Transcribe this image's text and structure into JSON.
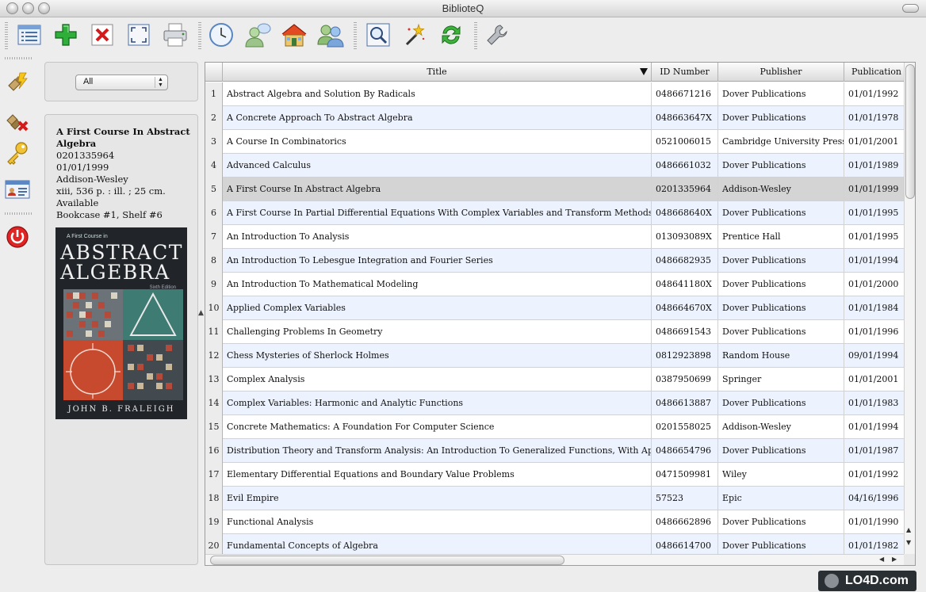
{
  "window": {
    "title": "BiblioteQ"
  },
  "toolbar": {
    "items": [
      {
        "icon": "list-view-icon"
      },
      {
        "icon": "add-icon"
      },
      {
        "icon": "delete-icon"
      },
      {
        "icon": "fullscreen-icon"
      },
      {
        "icon": "printer-icon"
      },
      {
        "icon": "clock-icon"
      },
      {
        "icon": "user-chat-icon"
      },
      {
        "icon": "home-icon"
      },
      {
        "icon": "users-icon"
      },
      {
        "icon": "search-icon"
      },
      {
        "icon": "magic-wand-icon"
      },
      {
        "icon": "refresh-icon"
      },
      {
        "icon": "wrench-icon"
      }
    ]
  },
  "side_toolbar": {
    "items": [
      {
        "icon": "connect-icon"
      },
      {
        "icon": "disconnect-icon"
      },
      {
        "icon": "key-icon"
      },
      {
        "icon": "id-card-icon"
      },
      {
        "icon": "power-icon"
      }
    ]
  },
  "filter": {
    "selected": "All"
  },
  "details": {
    "title": "A First Course In Abstract Algebra",
    "id": "0201335964",
    "date": "01/01/1999",
    "publisher": "Addison-Wesley",
    "description": "xiii, 536 p. : ill. ; 25 cm.",
    "availability": "Available",
    "location": "Bookcase #1, Shelf #6",
    "cover": {
      "small_text": "A First Course in",
      "line1": "ABSTRACT",
      "line2": "ALGEBRA",
      "edition": "Sixth Edition",
      "author": "JOHN B. FRALEIGH"
    }
  },
  "table": {
    "columns": [
      "Title",
      "ID Number",
      "Publisher",
      "Publication D"
    ],
    "selected_row": 5,
    "rows": [
      {
        "n": "1",
        "title": "Abstract Algebra and Solution By Radicals",
        "id": "0486671216",
        "publisher": "Dover Publications",
        "date": "01/01/1992"
      },
      {
        "n": "2",
        "title": "A Concrete Approach To Abstract Algebra",
        "id": "048663647X",
        "publisher": "Dover Publications",
        "date": "01/01/1978"
      },
      {
        "n": "3",
        "title": "A Course In Combinatorics",
        "id": "0521006015",
        "publisher": "Cambridge University Press",
        "date": "01/01/2001"
      },
      {
        "n": "4",
        "title": "Advanced Calculus",
        "id": "0486661032",
        "publisher": "Dover Publications",
        "date": "01/01/1989"
      },
      {
        "n": "5",
        "title": "A First Course In Abstract Algebra",
        "id": "0201335964",
        "publisher": "Addison-Wesley",
        "date": "01/01/1999"
      },
      {
        "n": "6",
        "title": "A First Course In Partial Differential Equations With Complex Variables and Transform Methods",
        "id": "048668640X",
        "publisher": "Dover Publications",
        "date": "01/01/1995"
      },
      {
        "n": "7",
        "title": "An Introduction To Analysis",
        "id": "013093089X",
        "publisher": "Prentice Hall",
        "date": "01/01/1995"
      },
      {
        "n": "8",
        "title": "An Introduction To Lebesgue Integration and Fourier Series",
        "id": "0486682935",
        "publisher": "Dover Publications",
        "date": "01/01/1994"
      },
      {
        "n": "9",
        "title": "An Introduction To Mathematical Modeling",
        "id": "048641180X",
        "publisher": "Dover Publications",
        "date": "01/01/2000"
      },
      {
        "n": "10",
        "title": "Applied Complex Variables",
        "id": "048664670X",
        "publisher": "Dover Publications",
        "date": "01/01/1984"
      },
      {
        "n": "11",
        "title": "Challenging Problems In Geometry",
        "id": "0486691543",
        "publisher": "Dover Publications",
        "date": "01/01/1996"
      },
      {
        "n": "12",
        "title": "Chess Mysteries of Sherlock Holmes",
        "id": "0812923898",
        "publisher": "Random House",
        "date": "09/01/1994"
      },
      {
        "n": "13",
        "title": "Complex Analysis",
        "id": "0387950699",
        "publisher": "Springer",
        "date": "01/01/2001"
      },
      {
        "n": "14",
        "title": "Complex Variables: Harmonic and Analytic Functions",
        "id": "0486613887",
        "publisher": "Dover Publications",
        "date": "01/01/1983"
      },
      {
        "n": "15",
        "title": "Concrete Mathematics: A Foundation For Computer Science",
        "id": "0201558025",
        "publisher": "Addison-Wesley",
        "date": "01/01/1994"
      },
      {
        "n": "16",
        "title": "Distribution Theory and Transform Analysis: An Introduction To Generalized Functions, With Applications",
        "id": "0486654796",
        "publisher": "Dover Publications",
        "date": "01/01/1987"
      },
      {
        "n": "17",
        "title": "Elementary Differential Equations and Boundary Value Problems",
        "id": "0471509981",
        "publisher": "Wiley",
        "date": "01/01/1992"
      },
      {
        "n": "18",
        "title": "Evil Empire",
        "id": "57523",
        "publisher": "Epic",
        "date": "04/16/1996"
      },
      {
        "n": "19",
        "title": "Functional Analysis",
        "id": "0486662896",
        "publisher": "Dover Publications",
        "date": "01/01/1990"
      },
      {
        "n": "20",
        "title": "Fundamental Concepts of Algebra",
        "id": "0486614700",
        "publisher": "Dover Publications",
        "date": "01/01/1982"
      }
    ]
  },
  "watermark": {
    "text": "LO4D.com"
  }
}
